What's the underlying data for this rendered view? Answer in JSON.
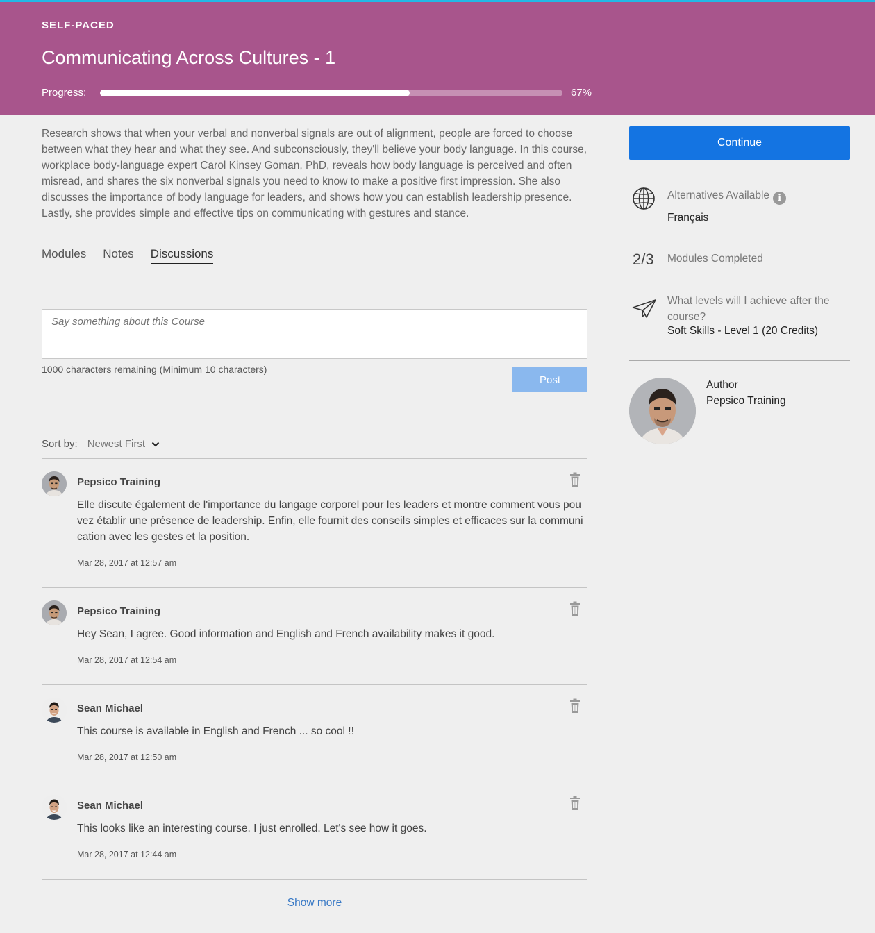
{
  "header": {
    "eyebrow": "SELF-PACED",
    "title": "Communicating Across Cultures - 1",
    "progress_label": "Progress:",
    "progress_value": 0.67,
    "progress_text": "67%"
  },
  "description": "Research shows that when your verbal and nonverbal signals are out of alignment, people are forced to choose between what they hear and what they see. And subconsciously, they'll believe your body language. In this course, workplace body-language expert Carol Kinsey Goman, PhD, reveals how body language is perceived and often misread, and shares the six nonverbal signals you need to know to make a positive first impression. She also discusses the importance of body language for leaders, and shows how you can establish leadership presence. Lastly, she provides simple and effective tips on communicating with gestures and stance.",
  "tabs": [
    {
      "label": "Modules",
      "active": false
    },
    {
      "label": "Notes",
      "active": false
    },
    {
      "label": "Discussions",
      "active": true
    }
  ],
  "composer": {
    "placeholder": "Say something about this Course",
    "char_count": "1000 characters remaining",
    "min_note": "(Minimum 10 characters)",
    "post_label": "Post"
  },
  "sort": {
    "label": "Sort by:",
    "value": "Newest First"
  },
  "comments": [
    {
      "author": "Pepsico Training",
      "text": "Elle discute également de l'importance du langage corporel pour les leaders et montre comment vous pouvez établir une présence de leadership. Enfin, elle fournit des conseils simples et efficaces sur la communication avec les gestes et la position.",
      "time": "Mar 28, 2017 at 12:57 am",
      "avatar": "pepsico-avatar"
    },
    {
      "author": "Pepsico Training",
      "text": "Hey Sean, I agree. Good information and English and French availability makes it good.",
      "time": "Mar 28, 2017 at 12:54 am",
      "avatar": "pepsico-avatar"
    },
    {
      "author": "Sean Michael",
      "text": "This course is available in English and French ... so cool !!",
      "time": "Mar 28, 2017 at 12:50 am",
      "avatar": "sean-avatar"
    },
    {
      "author": "Sean Michael",
      "text": "This looks like an interesting course. I just enrolled. Let's see how it goes.",
      "time": "Mar 28, 2017 at 12:44 am",
      "avatar": "sean-avatar"
    }
  ],
  "show_more": "Show more",
  "sidebar": {
    "continue_label": "Continue",
    "alternatives_label": "Alternatives Available",
    "alternatives_value": "Français",
    "modules_count": "2/3",
    "modules_label": "Modules Completed",
    "levels_question": "What levels will I achieve after the course?",
    "levels_value": "Soft Skills - Level 1 (20 Credits)",
    "author_label": "Author",
    "author_name": "Pepsico Training"
  },
  "colors": {
    "header_bg": "#a8558c",
    "accent_top": "#22b8e6",
    "continue_bg": "#1474e2",
    "post_disabled_bg": "#8ab8ee",
    "link": "#3a7ac6"
  }
}
